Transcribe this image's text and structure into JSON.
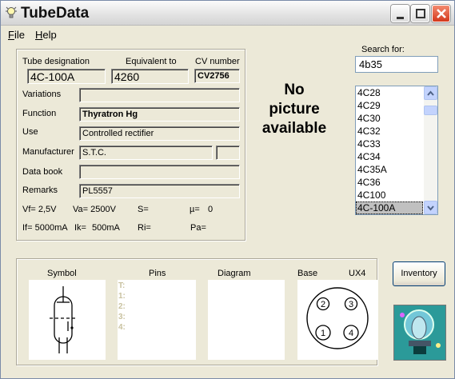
{
  "window": {
    "title": "TubeData",
    "colors": {
      "close": "#d4391c",
      "face": "#ece9d8"
    }
  },
  "menu": {
    "file": "File",
    "file_mnemonic": "F",
    "file_rest": "ile",
    "help": "Help",
    "help_mnemonic": "H",
    "help_rest": "elp"
  },
  "labels": {
    "tube_designation": "Tube designation",
    "equivalent_to": "Equivalent to",
    "cv_number": "CV number",
    "variations": "Variations",
    "function": "Function",
    "use": "Use",
    "manufacturer": "Manufacturer",
    "data_book": "Data book",
    "remarks": "Remarks"
  },
  "fields": {
    "tube_designation": "4C-100A",
    "equivalent_to": "4260",
    "cv_number": "CV2756",
    "variations": "",
    "function": "Thyratron Hg",
    "use": "Controlled rectifier",
    "manufacturer": "S.T.C.",
    "manufacturer_extra": "",
    "data_book": "",
    "remarks": "PL5557"
  },
  "params": {
    "vf": "Vf= 2,5V",
    "va": "Va= 2500V",
    "s": "S=",
    "mu": "µ=",
    "mu_val": "0",
    "if": "If= 5000mA",
    "ik": "Ik=",
    "ik_val": "500mA",
    "ri": "Ri=",
    "pa": "Pa="
  },
  "no_picture": [
    "No",
    "picture",
    "available"
  ],
  "search": {
    "label": "Search for:",
    "value": "4b35"
  },
  "tube_list": [
    "4C28",
    "4C29",
    "4C30",
    "4C32",
    "4C33",
    "4C34",
    "4C35A",
    "4C36",
    "4C100",
    "4C-100A"
  ],
  "selected_tube": "4C-100A",
  "bottom": {
    "symbol": "Symbol",
    "pins": "Pins",
    "diagram": "Diagram",
    "base": "Base",
    "base_type": "UX4",
    "pins_lines": [
      "T:",
      "1:",
      "2:",
      "3:",
      "4:"
    ],
    "base_pins": [
      "2",
      "3",
      "1",
      "4"
    ]
  },
  "inventory_button": "Inventory",
  "icons": [
    "lightbulb-icon",
    "minimize-icon",
    "maximize-icon",
    "close-icon",
    "scroll-up-icon",
    "scroll-down-icon",
    "tube-symbol-icon",
    "tube-logo-icon"
  ]
}
